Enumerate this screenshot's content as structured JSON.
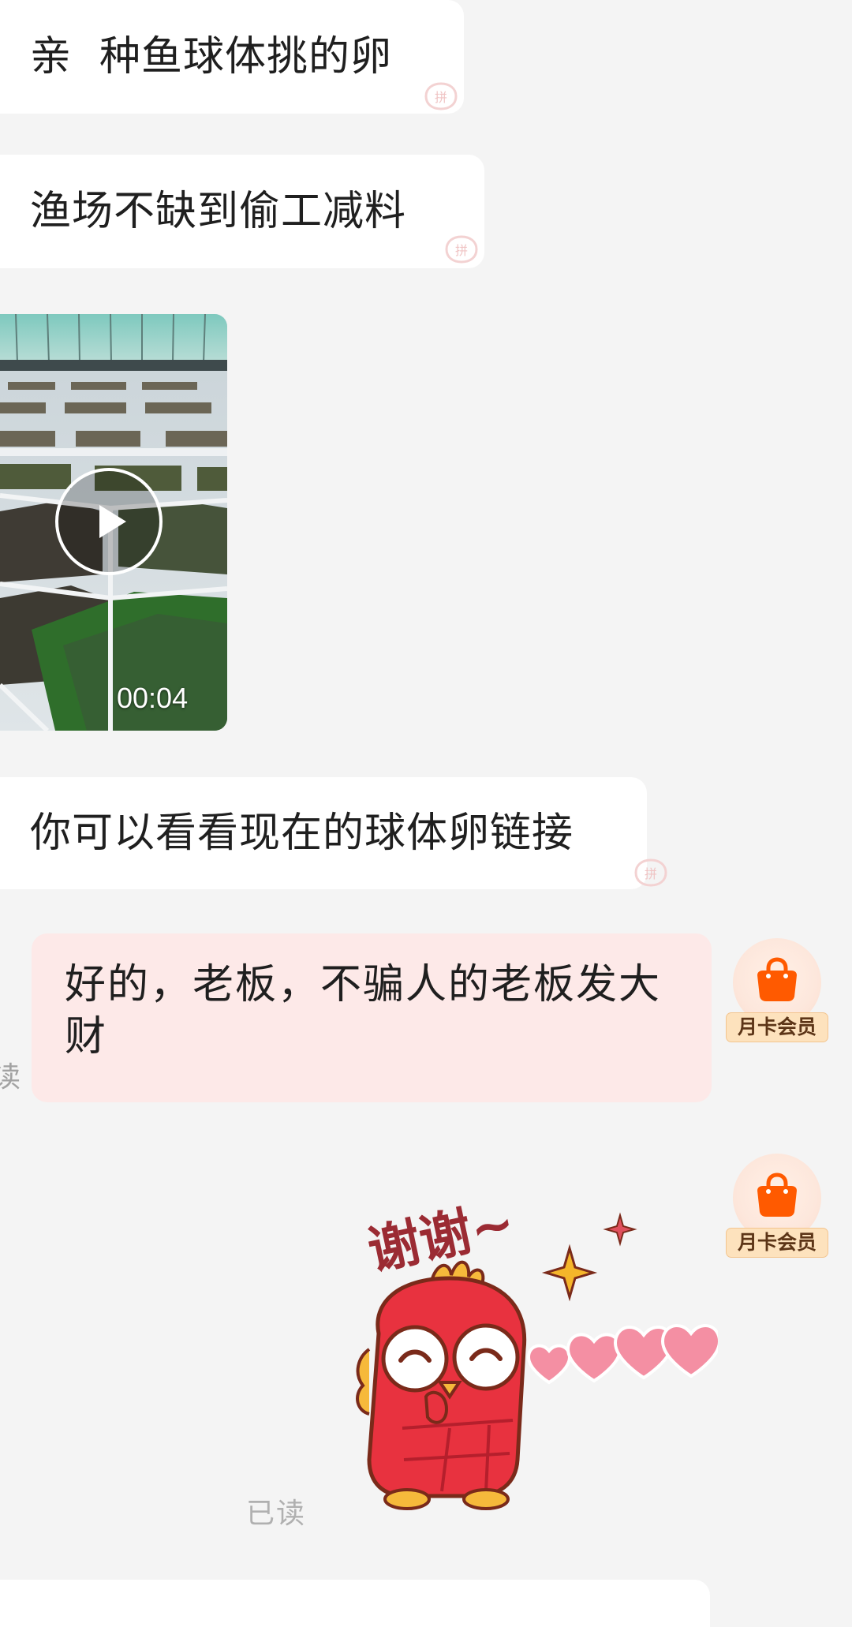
{
  "chat": {
    "messages": [
      {
        "sender": "shop",
        "type": "text",
        "text": "亲  种鱼球体挑的卵"
      },
      {
        "sender": "shop",
        "type": "text",
        "text": "渔场不缺到偷工减料"
      },
      {
        "sender": "shop",
        "type": "video",
        "duration": "00:04"
      },
      {
        "sender": "shop",
        "type": "text",
        "text": "你可以看看现在的球体卵链接"
      },
      {
        "sender": "me",
        "type": "text",
        "text": "好的，老板，不骗人的老板发大财",
        "read_status_partial": "读"
      },
      {
        "sender": "me",
        "type": "sticker",
        "sticker_text": "谢谢~",
        "read_status": "已读"
      }
    ],
    "my_badge": "月卡会员"
  },
  "colors": {
    "page_background": "#f4f4f4",
    "incoming_bubble": "#ffffff",
    "outgoing_bubble": "#fde9e8",
    "accent_orange": "#ff5a00",
    "badge_background": "#fde2bd",
    "read_text": "#b0b0b0"
  },
  "icons": {
    "watermark": "pinduoduo-watermark-icon",
    "avatar": "shopping-bag-icon",
    "video": "play-icon"
  }
}
